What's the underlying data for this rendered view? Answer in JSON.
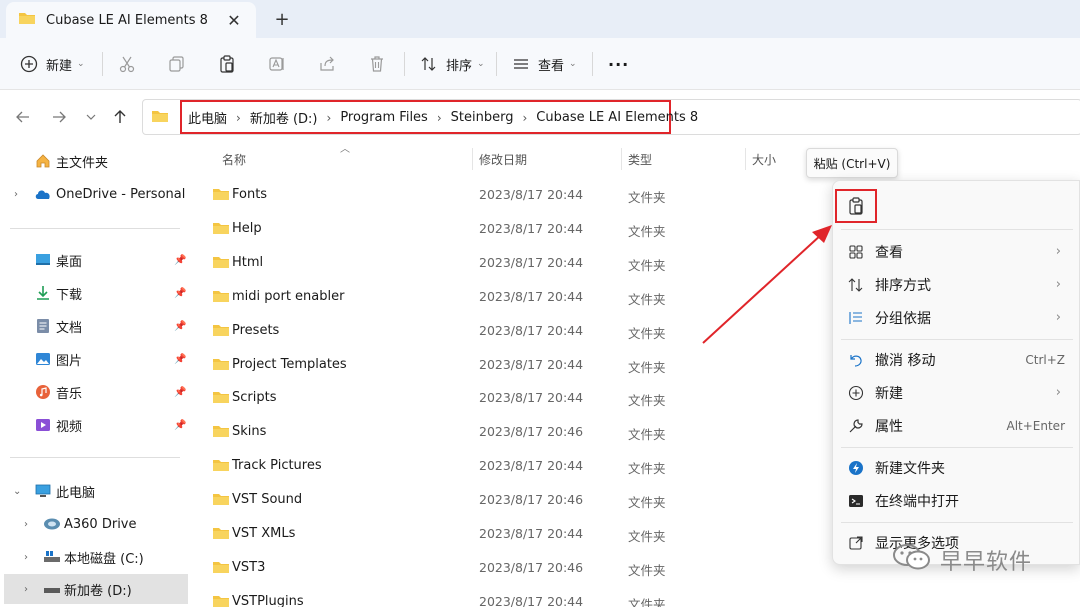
{
  "window": {
    "tab_title": "Cubase LE AI Elements 8",
    "tab_close": "✕",
    "new_tab": "+"
  },
  "toolbar": {
    "new_label": "新建",
    "sort_label": "排序",
    "view_label": "查看",
    "more_label": "···"
  },
  "breadcrumbs": [
    "此电脑",
    "新加卷 (D:)",
    "Program Files",
    "Steinberg",
    "Cubase LE AI Elements 8"
  ],
  "sidebar": {
    "home": "主文件夹",
    "onedrive": "OneDrive - Personal",
    "quick": [
      {
        "label": "桌面",
        "icon": "desktop-icon"
      },
      {
        "label": "下载",
        "icon": "download-icon"
      },
      {
        "label": "文档",
        "icon": "document-icon"
      },
      {
        "label": "图片",
        "icon": "pictures-icon"
      },
      {
        "label": "音乐",
        "icon": "music-icon"
      },
      {
        "label": "视频",
        "icon": "video-icon"
      }
    ],
    "this_pc": "此电脑",
    "drives": [
      {
        "label": "A360 Drive"
      },
      {
        "label": "本地磁盘 (C:)"
      },
      {
        "label": "新加卷 (D:)"
      }
    ]
  },
  "columns": {
    "name": "名称",
    "date": "修改日期",
    "type": "类型",
    "size": "大小"
  },
  "files": [
    {
      "name": "Fonts",
      "date": "2023/8/17 20:44",
      "type": "文件夹"
    },
    {
      "name": "Help",
      "date": "2023/8/17 20:44",
      "type": "文件夹"
    },
    {
      "name": "Html",
      "date": "2023/8/17 20:44",
      "type": "文件夹"
    },
    {
      "name": "midi port enabler",
      "date": "2023/8/17 20:44",
      "type": "文件夹"
    },
    {
      "name": "Presets",
      "date": "2023/8/17 20:44",
      "type": "文件夹"
    },
    {
      "name": "Project Templates",
      "date": "2023/8/17 20:44",
      "type": "文件夹"
    },
    {
      "name": "Scripts",
      "date": "2023/8/17 20:44",
      "type": "文件夹"
    },
    {
      "name": "Skins",
      "date": "2023/8/17 20:46",
      "type": "文件夹"
    },
    {
      "name": "Track Pictures",
      "date": "2023/8/17 20:44",
      "type": "文件夹"
    },
    {
      "name": "VST Sound",
      "date": "2023/8/17 20:46",
      "type": "文件夹"
    },
    {
      "name": "VST XMLs",
      "date": "2023/8/17 20:44",
      "type": "文件夹"
    },
    {
      "name": "VST3",
      "date": "2023/8/17 20:46",
      "type": "文件夹"
    },
    {
      "name": "VSTPlugins",
      "date": "2023/8/17 20:44",
      "type": "文件夹"
    }
  ],
  "tooltip": "粘贴 (Ctrl+V)",
  "context_menu": {
    "view": "查看",
    "sort_by": "排序方式",
    "group_by": "分组依据",
    "undo": "撤消 移动",
    "undo_key": "Ctrl+Z",
    "new": "新建",
    "properties": "属性",
    "properties_key": "Alt+Enter",
    "new_folder": "新建文件夹",
    "open_terminal": "在终端中打开",
    "more_options": "显示更多选项"
  },
  "watermark": "早早软件",
  "colors": {
    "highlight_red": "#e0252a",
    "folder_yellow": "#f4c542",
    "accent_blue": "#1a73c8"
  }
}
